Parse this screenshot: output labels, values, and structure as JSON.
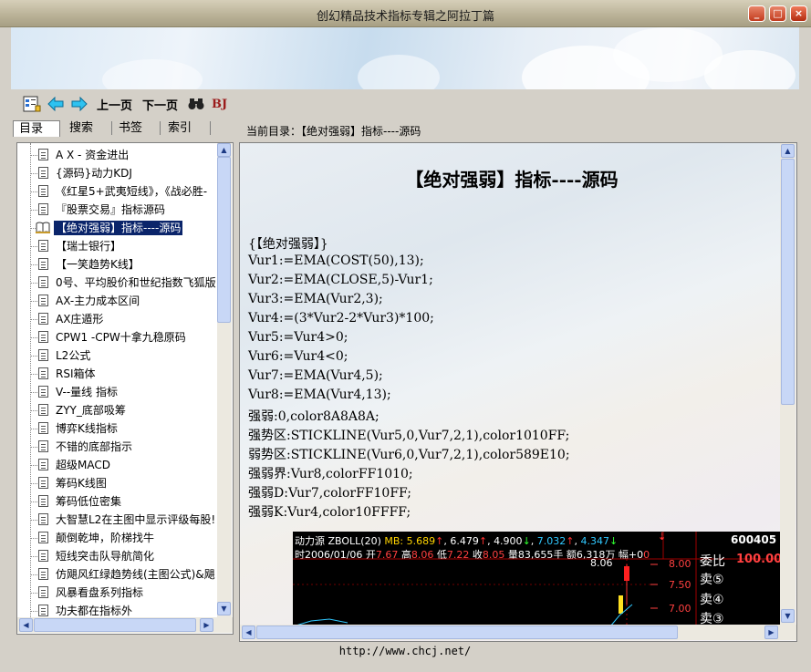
{
  "window": {
    "title": "创幻精品技术指标专辑之阿拉丁篇"
  },
  "toolbar": {
    "prev_label": "上一页",
    "next_label": "下一页",
    "bj_label": "BJ"
  },
  "tabs": [
    "目录",
    "搜索",
    "书签",
    "索引"
  ],
  "tree": {
    "items": [
      "A X - 资金进出",
      "{源码}动力KDJ",
      "《红星5+武夷短线》，《战必胜-",
      "『股票交易』指标源码",
      "【绝对强弱】指标----源码",
      "【瑞士银行】",
      "【一笑趋势K线】",
      "0号、平均股价和世纪指数飞狐版",
      "AX-主力成本区间",
      "AX庄遁形",
      "CPW1 -CPW十拿九稳原码",
      "L2公式",
      "RSI箱体",
      "V--量线 指标",
      "ZYY_底部吸筹",
      "博弈K线指标",
      "不错的底部指示",
      "超级MACD",
      "筹码K线图",
      "筹码低位密集",
      "大智慧L2在主图中显示评级每股!",
      "颠倒乾坤，阶梯找牛",
      "短线突击队导航简化",
      "仿飓风红绿趋势线(主图公式)&飓",
      "风暴看盘系列指标",
      "功夫都在指标外"
    ],
    "selected_index": 4
  },
  "path": {
    "text": "当前目录：【绝对强弱】指标----源码"
  },
  "doc": {
    "title": "【绝对强弱】指标----源码",
    "lines": [
      "{【绝对强弱】}",
      "Vur1:=EMA(COST(50),13);",
      "Vur2:=EMA(CLOSE,5)-Vur1;",
      "Vur3:=EMA(Vur2,3);",
      "Vur4:=(3*Vur2-2*Vur3)*100;",
      "Vur5:=Vur4>0;",
      "Vur6:=Vur4<0;",
      "Vur7:=EMA(Vur4,5);",
      "Vur8:=EMA(Vur4,13);",
      "强弱:0,color8A8A8A;",
      "强势区:STICKLINE(Vur5,0,Vur7,2,1),color1010FF;",
      "弱势区:STICKLINE(Vur6,0,Vur7,2,1),color589E10;",
      "强弱界:Vur8,colorFF1010;",
      "强弱D:Vur7,colorFF10FF;",
      "强弱K:Vur4,color10FFFF;"
    ]
  },
  "stock": {
    "line1_name": "动力源",
    "line1_ind": "ZBOLL(20)",
    "mb": "MB: 5.689",
    "v1": "6.479",
    "v2": "4.900",
    "v3": "7.032",
    "v4": "4.347",
    "line2_date": "时2006/01/06",
    "open_label": "开",
    "open": "7.67",
    "high_label": "高",
    "high": "8.06",
    "low_label": "低",
    "low": "7.22",
    "close_label": "收",
    "close": "8.05",
    "vol": "量83,655手",
    "amt": "额6,318万",
    "amp": "幅+0",
    "peak": "8.06",
    "axis": [
      "8.00",
      "7.50",
      "7.00"
    ],
    "code": "600405",
    "ratio_label": "委比",
    "ratio_value": "100.00",
    "sell5": "卖⑤",
    "sell4": "卖④",
    "sell3": "卖③"
  },
  "status": {
    "url": "http://www.chcj.net/"
  }
}
